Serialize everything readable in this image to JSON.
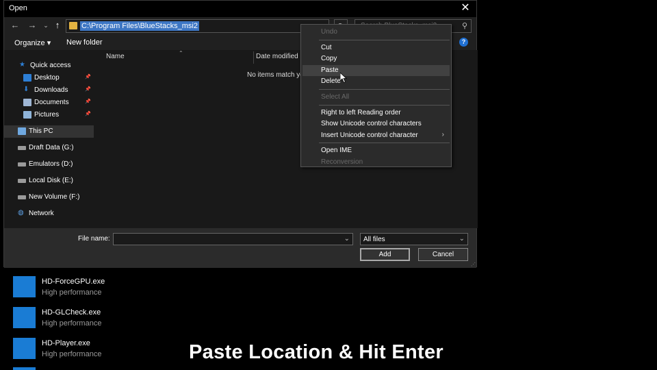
{
  "dialog": {
    "title": "Open",
    "close_glyph": "✕",
    "address_path": "C:\\Program Files\\BlueStacks_msi2",
    "search_placeholder": "Search BlueStacks_msi2",
    "toolbar": {
      "organize": "Organize ▾",
      "new_folder": "New folder"
    },
    "sidebar": [
      {
        "label": "Quick access",
        "icon": "star-icon",
        "pinned": false
      },
      {
        "label": "Desktop",
        "icon": "desktop-icon",
        "pinned": true
      },
      {
        "label": "Downloads",
        "icon": "download-icon",
        "pinned": true
      },
      {
        "label": "Documents",
        "icon": "document-icon",
        "pinned": true
      },
      {
        "label": "Pictures",
        "icon": "picture-icon",
        "pinned": true
      },
      {
        "label": "This PC",
        "icon": "computer-icon",
        "pinned": false
      },
      {
        "label": "Draft Data (G:)",
        "icon": "drive-icon",
        "pinned": false
      },
      {
        "label": "Emulators (D:)",
        "icon": "drive-icon",
        "pinned": false
      },
      {
        "label": "Local Disk (E:)",
        "icon": "drive-icon",
        "pinned": false
      },
      {
        "label": "New Volume (F:)",
        "icon": "drive-icon",
        "pinned": false
      },
      {
        "label": "Network",
        "icon": "network-icon",
        "pinned": false
      }
    ],
    "columns": {
      "name": "Name",
      "date_modified": "Date modified"
    },
    "empty_message": "No items match yo",
    "file_name_label": "File name:",
    "file_name_value": "",
    "file_type": "All files",
    "add_button": "Add",
    "cancel_button": "Cancel"
  },
  "context_menu": [
    {
      "label": "Undo",
      "disabled": true
    },
    {
      "separator": true
    },
    {
      "label": "Cut",
      "disabled": false
    },
    {
      "label": "Copy",
      "disabled": false
    },
    {
      "label": "Paste",
      "disabled": false,
      "hover": true
    },
    {
      "label": "Delete",
      "disabled": false
    },
    {
      "separator": true
    },
    {
      "label": "Select All",
      "disabled": true
    },
    {
      "separator": true
    },
    {
      "label": "Right to left Reading order",
      "disabled": false
    },
    {
      "label": "Show Unicode control characters",
      "disabled": false
    },
    {
      "label": "Insert Unicode control character",
      "disabled": false,
      "submenu": true
    },
    {
      "separator": true
    },
    {
      "label": "Open IME",
      "disabled": false
    },
    {
      "label": "Reconversion",
      "disabled": true
    }
  ],
  "apps": [
    {
      "name": "HD-ForceGPU.exe",
      "sub": "High performance"
    },
    {
      "name": "HD-GLCheck.exe",
      "sub": "High performance"
    },
    {
      "name": "HD-Player.exe",
      "sub": "High performance"
    }
  ],
  "caption": "Paste Location & Hit Enter",
  "colors": {
    "accent": "#1a7cd4",
    "selection": "#3d76c4",
    "folder": "#e3b341"
  }
}
